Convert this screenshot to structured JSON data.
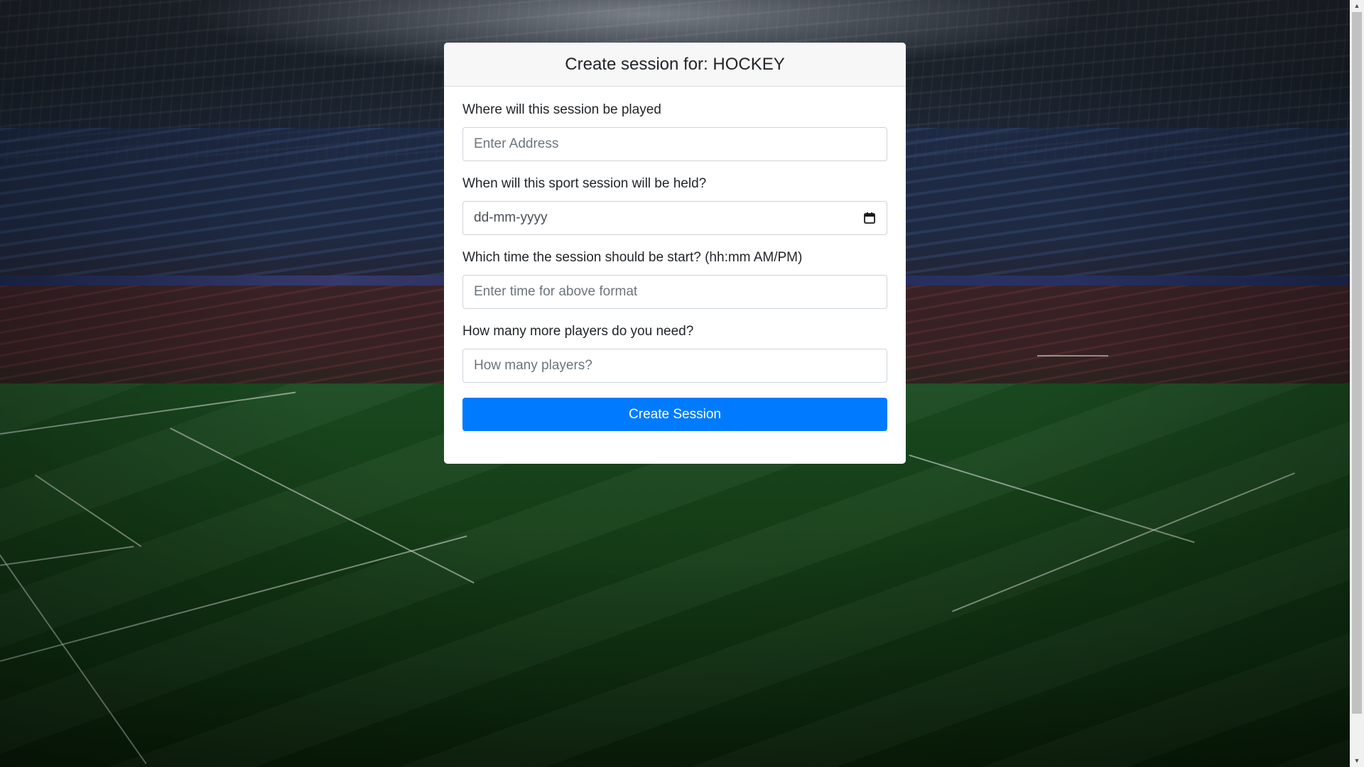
{
  "card": {
    "title": "Create session for: HOCKEY"
  },
  "form": {
    "address": {
      "label": "Where will this session be played",
      "placeholder": "Enter Address",
      "value": ""
    },
    "date": {
      "label": "When will this sport session will be held?",
      "placeholder": "dd-mm-yyyy",
      "icon": "calendar-icon"
    },
    "time": {
      "label": "Which time the session should be start? (hh:mm AM/PM)",
      "placeholder": "Enter time for above format",
      "value": ""
    },
    "players": {
      "label": "How many more players do you need?",
      "placeholder": "How many players?",
      "value": ""
    },
    "submit_label": "Create Session"
  },
  "colors": {
    "primary_button": "#007bff",
    "card_header_bg": "#f7f7f7",
    "input_border": "#ced4da"
  },
  "background": {
    "image": "stadium-photo"
  }
}
